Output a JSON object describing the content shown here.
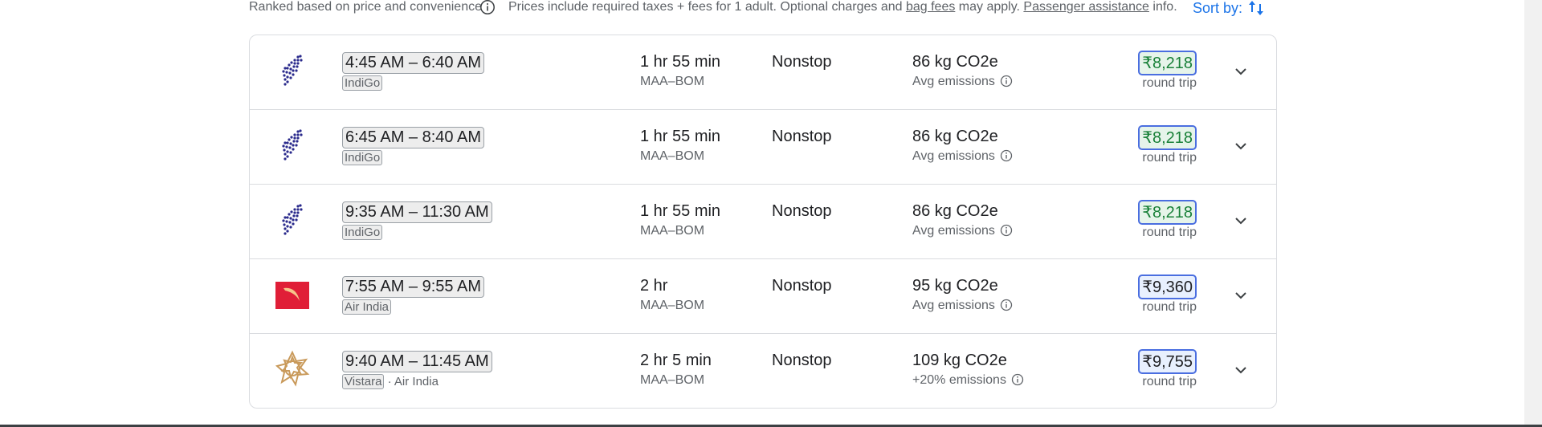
{
  "header": {
    "ranked_text": "Ranked based on price and convenience",
    "prices_pre": "Prices include required taxes + fees for 1 adult. Optional charges and ",
    "bag_fees": "bag fees",
    "prices_mid": " may apply. ",
    "passenger_assistance": "Passenger assistance",
    "prices_post": " info.",
    "sort_label": "Sort by:"
  },
  "colors": {
    "accent": "#1a73e8",
    "price_green": "#188038",
    "indigo": "#2a2a8c",
    "air_india": "#e01e37",
    "vistara": "#c99a5b"
  },
  "flights": [
    {
      "logo": "indigo-logo-icon",
      "times": "4:45 AM – 6:40 AM",
      "airline": "IndiGo",
      "partner": "",
      "duration": "1 hr 55 min",
      "route": "MAA–BOM",
      "stops": "Nonstop",
      "emissions": "86 kg CO2e",
      "emissions_note": "Avg emissions",
      "price": "₹8,218",
      "price_style": "green",
      "price_note": "round trip"
    },
    {
      "logo": "indigo-logo-icon",
      "times": "6:45 AM – 8:40 AM",
      "airline": "IndiGo",
      "partner": "",
      "duration": "1 hr 55 min",
      "route": "MAA–BOM",
      "stops": "Nonstop",
      "emissions": "86 kg CO2e",
      "emissions_note": "Avg emissions",
      "price": "₹8,218",
      "price_style": "green",
      "price_note": "round trip"
    },
    {
      "logo": "indigo-logo-icon",
      "times": "9:35 AM – 11:30 AM",
      "airline": "IndiGo",
      "partner": "",
      "duration": "1 hr 55 min",
      "route": "MAA–BOM",
      "stops": "Nonstop",
      "emissions": "86 kg CO2e",
      "emissions_note": "Avg emissions",
      "price": "₹8,218",
      "price_style": "green",
      "price_note": "round trip"
    },
    {
      "logo": "air-india-logo-icon",
      "times": "7:55 AM – 9:55 AM",
      "airline": "Air India",
      "partner": "",
      "duration": "2 hr",
      "route": "MAA–BOM",
      "stops": "Nonstop",
      "emissions": "95 kg CO2e",
      "emissions_note": "Avg emissions",
      "price": "₹9,360",
      "price_style": "dark",
      "price_note": "round trip"
    },
    {
      "logo": "vistara-logo-icon",
      "times": "9:40 AM – 11:45 AM",
      "airline": "Vistara",
      "partner": " · Air India",
      "duration": "2 hr 5 min",
      "route": "MAA–BOM",
      "stops": "Nonstop",
      "emissions": "109 kg CO2e",
      "emissions_note": "+20% emissions",
      "price": "₹9,755",
      "price_style": "dark",
      "price_note": "round trip"
    }
  ]
}
